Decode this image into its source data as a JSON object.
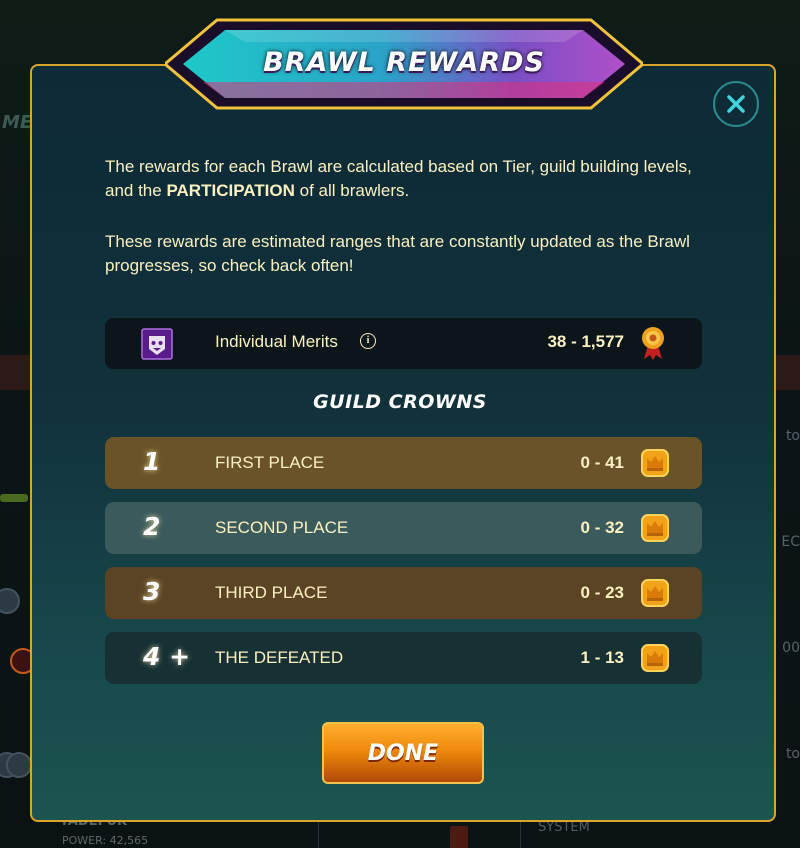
{
  "background": {
    "left_tag": "ME",
    "player_name": "TADEFUK",
    "player_power": "POWER: 42,565",
    "system_label": "SYSTEM",
    "right_fragments": [
      "to",
      "EC",
      "00",
      "to"
    ]
  },
  "modal": {
    "title": "BRAWL REWARDS",
    "intro_p1_before": "The rewards for each Brawl are calculated based on Tier, guild building levels, and the ",
    "intro_p1_bold": "PARTICIPATION",
    "intro_p1_after": " of all brawlers.",
    "intro_p2": "These rewards are estimated ranges that are constantly updated as the Brawl progresses, so check back often!",
    "merits": {
      "label": "Individual Merits",
      "info_icon": "info-icon",
      "value": "38 - 1,577",
      "icon": "merit-medal-icon"
    },
    "section_title": "GUILD CROWNS",
    "places": [
      {
        "num": "1",
        "name": "FIRST PLACE",
        "range": "0 - 41",
        "color": "#6a5327"
      },
      {
        "num": "2",
        "name": "SECOND PLACE",
        "range": "0 - 32",
        "color": "#3b5a5c"
      },
      {
        "num": "3",
        "name": "THIRD PLACE",
        "range": "0 - 23",
        "color": "#5a4424"
      },
      {
        "num": "4 +",
        "name": "THE DEFEATED",
        "range": "1 - 13",
        "color": "#163034"
      }
    ],
    "done_label": "DONE"
  },
  "colors": {
    "accent_gold": "#d9a62a",
    "text_cream": "#fbf1c0",
    "close_teal": "#2b8a8e"
  }
}
